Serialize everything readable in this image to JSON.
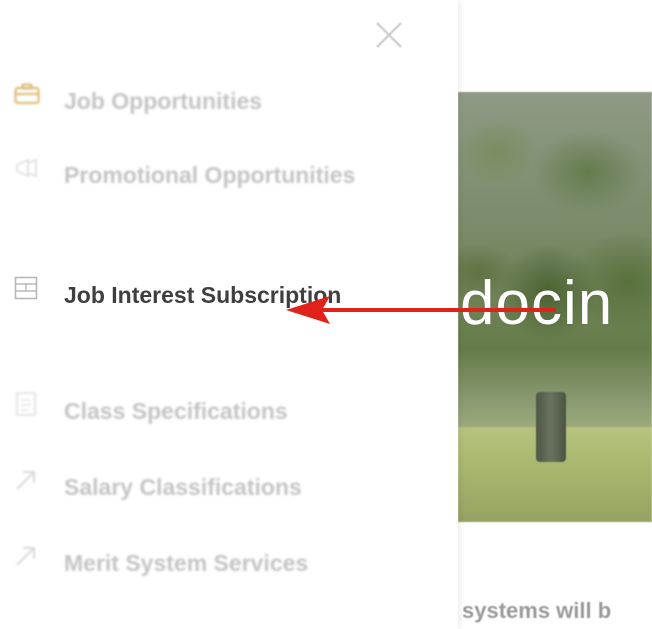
{
  "background": {
    "hero_text": "docin",
    "body_text": "systems will b"
  },
  "menu": {
    "close_icon": "close-icon",
    "items": [
      {
        "label": "Job Opportunities",
        "icon": "briefcase-icon"
      },
      {
        "label": "Promotional Opportunities",
        "icon": "megaphone-icon"
      },
      {
        "label": "Job Interest Subscription",
        "icon": "table-icon"
      },
      {
        "label": "Class Specifications",
        "icon": "document-icon"
      },
      {
        "label": "Salary Classifications",
        "icon": "external-link-arrow-icon"
      },
      {
        "label": "Merit System Services",
        "icon": "external-link-arrow-icon"
      }
    ]
  },
  "annotation": {
    "arrow_color": "#e0221a",
    "points_to": "Job Interest Subscription"
  },
  "colors": {
    "accent_icon": "#d9b56a",
    "focused_text": "#3f3f3f",
    "muted_text": "#c4c4c4"
  }
}
